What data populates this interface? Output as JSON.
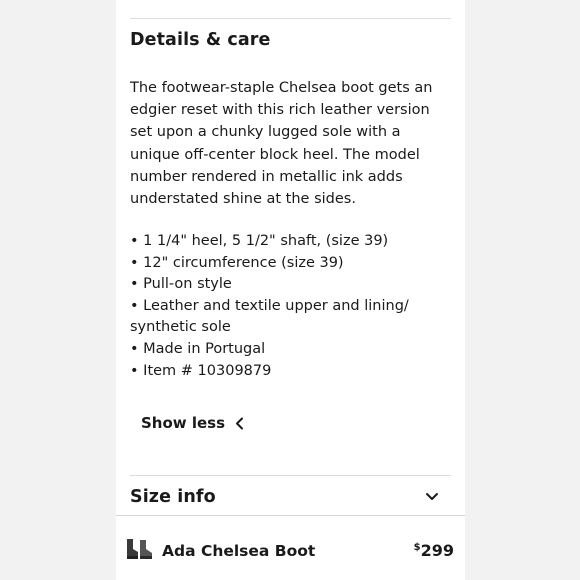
{
  "details": {
    "title": "Details & care",
    "description": "The footwear-staple Chelsea boot gets an edgier reset with this rich leather version set upon a chunky lugged sole with a unique off-center block heel. The model number rendered in metallic ink adds understated shine at the sides.",
    "bullets": [
      "• 1 1/4\" heel, 5 1/2\" shaft, (size 39)",
      "• 12\" circumference (size 39)",
      "• Pull-on style",
      "• Leather and textile upper and lining/ synthetic sole",
      "• Made in Portugal",
      "• Item # 10309879"
    ],
    "toggle_label": "Show less",
    "toggle_icon": "chevron-left-icon"
  },
  "size_info": {
    "title": "Size info",
    "toggle_icon": "chevron-down-icon"
  },
  "footer": {
    "product_name": "Ada Chelsea Boot",
    "price_currency": "$",
    "price_amount": "299",
    "thumb_icon": "boot-thumbnail"
  },
  "colors": {
    "background": "#f2f2f2",
    "panel": "#ffffff",
    "text": "#1a1a1a",
    "divider": "#dcdcdc"
  }
}
